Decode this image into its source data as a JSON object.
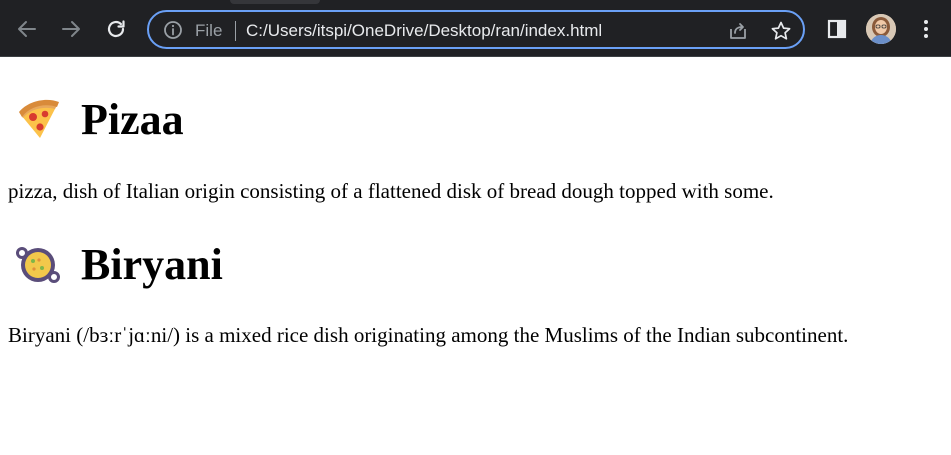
{
  "browser": {
    "scheme_label": "File",
    "url": "C:/Users/itspi/OneDrive/Desktop/ran/index.html"
  },
  "sections": [
    {
      "icon": "pizza-icon",
      "title": "Pizaa",
      "description": "pizza, dish of Italian origin consisting of a flattened disk of bread dough topped with some."
    },
    {
      "icon": "paella-pan-icon",
      "title": "Biryani",
      "description": "Biryani (/bɜːrˈjɑːni/) is a mixed rice dish originating among the Muslims of the Indian subcontinent."
    }
  ],
  "colors": {
    "toolbar_bg": "#202124",
    "omnibox_border": "#6aa0f6",
    "url_text": "#e8eaed",
    "scheme_text": "#9aa0a6"
  }
}
